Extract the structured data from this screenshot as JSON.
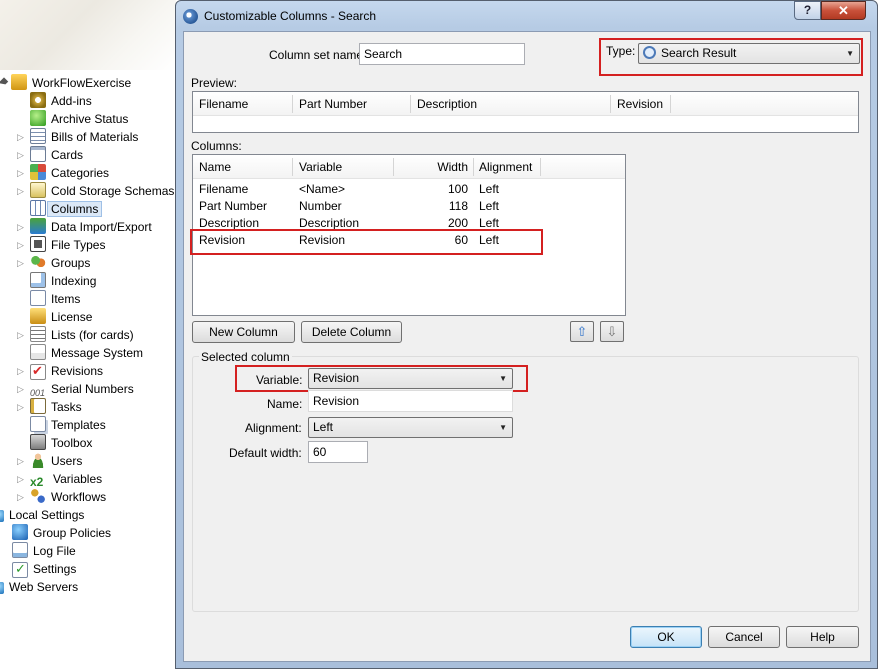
{
  "tree": {
    "root": "WorkFlowExercise",
    "items": [
      {
        "label": "Add-ins",
        "icon": "gear-icon",
        "expander": false
      },
      {
        "label": "Archive Status",
        "icon": "status-icon",
        "expander": false
      },
      {
        "label": "Bills of Materials",
        "icon": "bom-icon",
        "expander": true
      },
      {
        "label": "Cards",
        "icon": "card-icon",
        "expander": true
      },
      {
        "label": "Categories",
        "icon": "categories-icon",
        "expander": true
      },
      {
        "label": "Cold Storage Schemas",
        "icon": "cold-storage-icon",
        "expander": true
      },
      {
        "label": "Columns",
        "icon": "columns-icon",
        "expander": false,
        "selected": true
      },
      {
        "label": "Data Import/Export",
        "icon": "import-export-icon",
        "expander": true
      },
      {
        "label": "File Types",
        "icon": "file-types-icon",
        "expander": true
      },
      {
        "label": "Groups",
        "icon": "groups-icon",
        "expander": true
      },
      {
        "label": "Indexing",
        "icon": "indexing-icon",
        "expander": false
      },
      {
        "label": "Items",
        "icon": "items-icon",
        "expander": false
      },
      {
        "label": "License",
        "icon": "license-icon",
        "expander": false
      },
      {
        "label": "Lists (for cards)",
        "icon": "lists-icon",
        "expander": true
      },
      {
        "label": "Message System",
        "icon": "message-icon",
        "expander": false
      },
      {
        "label": "Revisions",
        "icon": "revisions-icon",
        "expander": true
      },
      {
        "label": "Serial Numbers",
        "icon": "serial-numbers-icon",
        "expander": true
      },
      {
        "label": "Tasks",
        "icon": "tasks-icon",
        "expander": true
      },
      {
        "label": "Templates",
        "icon": "templates-icon",
        "expander": false
      },
      {
        "label": "Toolbox",
        "icon": "toolbox-icon",
        "expander": false
      },
      {
        "label": "Users",
        "icon": "users-icon",
        "expander": true
      },
      {
        "label": "Variables",
        "icon": "variables-icon",
        "expander": true
      },
      {
        "label": "Workflows",
        "icon": "workflows-icon",
        "expander": true
      }
    ],
    "local_settings": "Local Settings",
    "local_items": [
      {
        "label": "Group Policies",
        "icon": "group-policies-icon"
      },
      {
        "label": "Log File",
        "icon": "log-file-icon"
      },
      {
        "label": "Settings",
        "icon": "settings-icon"
      }
    ],
    "web_servers": "Web Servers",
    "serial_glyph": "001",
    "vars_glyph": "x2"
  },
  "dialog": {
    "title": "Customizable Columns - Search",
    "help_label": "?",
    "close_label": "✕",
    "column_set_name_label": "Column set name:",
    "column_set_name_value": "Search",
    "type_label": "Type:",
    "type_value": "Search Result",
    "preview_label": "Preview:",
    "preview_headers": [
      "Filename",
      "Part Number",
      "Description",
      "Revision"
    ],
    "columns_label": "Columns:",
    "columns_headers": {
      "name": "Name",
      "variable": "Variable",
      "width": "Width",
      "alignment": "Alignment"
    },
    "columns_rows": [
      {
        "name": "Filename",
        "variable": "<Name>",
        "width": "100",
        "alignment": "Left"
      },
      {
        "name": "Part Number",
        "variable": "Number",
        "width": "118",
        "alignment": "Left"
      },
      {
        "name": "Description",
        "variable": "Description",
        "width": "200",
        "alignment": "Left"
      },
      {
        "name": "Revision",
        "variable": "Revision",
        "width": "60",
        "alignment": "Left"
      }
    ],
    "new_column_label": "New Column",
    "delete_column_label": "Delete Column",
    "move_up_glyph": "⇧",
    "move_down_glyph": "⇩",
    "selected_column_label": "Selected column",
    "variable_label": "Variable:",
    "variable_value": "Revision",
    "name_label": "Name:",
    "name_value": "Revision",
    "alignment_label": "Alignment:",
    "alignment_value": "Left",
    "default_width_label": "Default width:",
    "default_width_value": "60",
    "ok_label": "OK",
    "cancel_label": "Cancel",
    "help_button_label": "Help"
  },
  "colors": {
    "highlight_red": "#d42020",
    "selection_blue": "#dbe8f7"
  }
}
